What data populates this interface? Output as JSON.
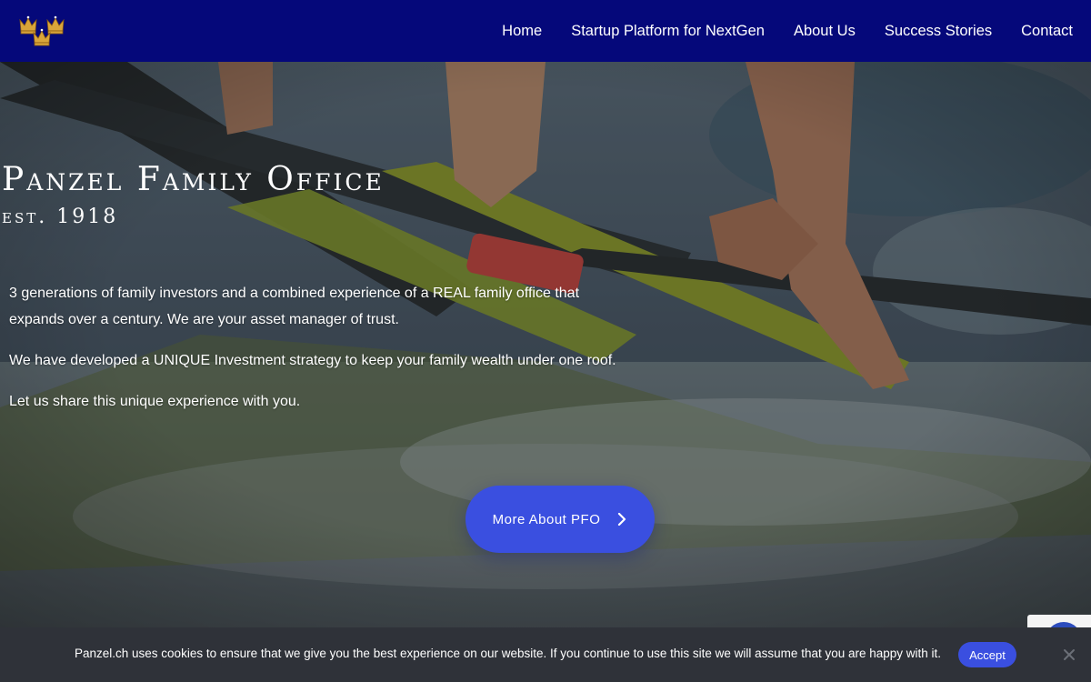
{
  "nav": {
    "items": [
      {
        "label": "Home"
      },
      {
        "label": "Startup Platform for NextGen"
      },
      {
        "label": "About Us"
      },
      {
        "label": "Success Stories"
      },
      {
        "label": "Contact"
      }
    ]
  },
  "hero": {
    "title": "Panzel Family Office",
    "subtitle": "est. 1918",
    "paragraphs": [
      "3 generations of family investors and a combined experience of a REAL family office that expands over a century. We are your asset manager of trust.",
      "We have developed a UNIQUE Investment strategy to keep your family wealth under one roof.",
      "Let us share this unique experience with you."
    ],
    "cta_label": "More About PFO"
  },
  "cookie": {
    "text": "Panzel.ch uses cookies to ensure that we give you the best experience on our website. If you continue to use this site we will assume that you are happy with it.",
    "accept_label": "Accept"
  },
  "colors": {
    "header_bg": "#05087a",
    "accent": "#3a4fe0",
    "cookie_bg": "#2f3239",
    "crown_gold": "#d9a53a"
  },
  "icons": {
    "logo": "crown-icon",
    "cta": "chevron-right-icon",
    "close": "close-icon"
  }
}
